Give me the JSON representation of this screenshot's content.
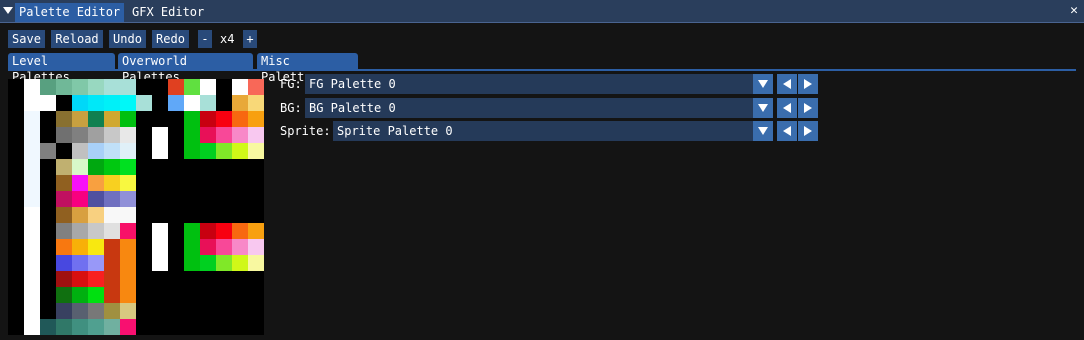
{
  "tabs": [
    {
      "label": "Palette Editor",
      "active": true
    },
    {
      "label": "GFX Editor",
      "active": false
    }
  ],
  "close_symbol": "✕",
  "toolbar": {
    "save": "Save",
    "reload": "Reload",
    "undo": "Undo",
    "redo": "Redo",
    "zoom_out": "-",
    "zoom": "x4",
    "zoom_in": "+"
  },
  "palette_tabs": [
    "Level Palettes",
    "Overworld Palettes",
    "Misc Palettes"
  ],
  "selectors": {
    "fg": {
      "label": "FG:",
      "value": "FG Palette 0"
    },
    "bg": {
      "label": "BG:",
      "value": "BG Palette 0"
    },
    "sprite": {
      "label": "Sprite:",
      "value": "Sprite Palette 0"
    }
  },
  "icons": {
    "collapse": "triangle-down-icon",
    "close": "close-icon",
    "dropdown": "triangle-down-icon",
    "prev": "triangle-left-icon",
    "next": "triangle-right-icon"
  },
  "colors": {
    "tabbar": "#2a3e5c",
    "active_tab": "#2c5ea4",
    "button": "#294a7a",
    "combo": "#253a59",
    "arrow_button": "#3a6dad",
    "background": "#141414"
  },
  "palette_grid": [
    [
      "#000000",
      "#ffffff",
      "#58a080",
      "#70b898",
      "#80c8a8",
      "#98d8c0",
      "#a8e0d8",
      "#a8e0d8",
      "#000000",
      "#000000",
      "#e04020",
      "#60e040",
      "#ffffff",
      "#000000",
      "#ffffff",
      "#f86858"
    ],
    [
      "#000000",
      "#ffffff",
      "#ffffff",
      "#000000",
      "#00d8f8",
      "#00e8f8",
      "#00f0f8",
      "#00f8f8",
      "#a8e0d8",
      "#000000",
      "#60a8f8",
      "#ffffff",
      "#a8e0d8",
      "#000000",
      "#e8a838",
      "#f8d878"
    ],
    [
      "#000000",
      "#f0f8ff",
      "#000000",
      "#887030",
      "#c8a040",
      "#108050",
      "#d0a830",
      "#00c010",
      "#000000",
      "#000000",
      "#000000",
      "#00c010",
      "#c80010",
      "#f80010",
      "#f86810",
      "#f8a010"
    ],
    [
      "#000000",
      "#f0f8ff",
      "#000000",
      "#707070",
      "#808080",
      "#a0a0a0",
      "#c8c8c8",
      "#e8e8e8",
      "#000000",
      "#ffffff",
      "#000000",
      "#00c010",
      "#e81058",
      "#f84898",
      "#f888c8",
      "#f8c8f0"
    ],
    [
      "#000000",
      "#f0f8ff",
      "#808080",
      "#000000",
      "#c0c0c0",
      "#a8d0f8",
      "#c0e0f8",
      "#e0f0f8",
      "#000000",
      "#ffffff",
      "#000000",
      "#00c010",
      "#00d020",
      "#80e828",
      "#d0f818",
      "#f8f8a0"
    ],
    [
      "#000000",
      "#f0f8ff",
      "#000000",
      "#c0b070",
      "#d8f8c8",
      "#00a810",
      "#00c810",
      "#00e020",
      "#000000",
      "#000000",
      "#000000",
      "#000000",
      "#000000",
      "#000000",
      "#000000",
      "#000000"
    ],
    [
      "#000000",
      "#f0f8ff",
      "#000000",
      "#906020",
      "#f810f8",
      "#f8a040",
      "#f8d020",
      "#f8f840",
      "#000000",
      "#000000",
      "#000000",
      "#000000",
      "#000000",
      "#000000",
      "#000000",
      "#000000"
    ],
    [
      "#000000",
      "#f0f8ff",
      "#000000",
      "#c01060",
      "#f80080",
      "#5050a0",
      "#7070c0",
      "#9090d8",
      "#000000",
      "#000000",
      "#000000",
      "#000000",
      "#000000",
      "#000000",
      "#000000",
      "#000000"
    ],
    [
      "#000000",
      "#ffffff",
      "#000000",
      "#906020",
      "#d8a040",
      "#f8d080",
      "#f8f8f8",
      "#f8f8f8",
      "#000000",
      "#000000",
      "#000000",
      "#000000",
      "#000000",
      "#000000",
      "#000000",
      "#000000"
    ],
    [
      "#000000",
      "#ffffff",
      "#000000",
      "#808080",
      "#a8a8a8",
      "#c8c8c8",
      "#e0e0e0",
      "#f81068",
      "#000000",
      "#ffffff",
      "#000000",
      "#00c010",
      "#c80010",
      "#f80010",
      "#f86810",
      "#f8a010"
    ],
    [
      "#000000",
      "#ffffff",
      "#000000",
      "#f87810",
      "#f8b008",
      "#f8e810",
      "#c83810",
      "#f88810",
      "#000000",
      "#ffffff",
      "#000000",
      "#00c010",
      "#e81058",
      "#f84898",
      "#f888c8",
      "#f8c8f0"
    ],
    [
      "#000000",
      "#ffffff",
      "#000000",
      "#4848e0",
      "#7070f0",
      "#9898f8",
      "#c83810",
      "#f88810",
      "#000000",
      "#ffffff",
      "#000000",
      "#00c010",
      "#00d020",
      "#80e828",
      "#d0f818",
      "#f8f8a0"
    ],
    [
      "#000000",
      "#ffffff",
      "#000000",
      "#a01010",
      "#d81010",
      "#f82020",
      "#c83810",
      "#f88810",
      "#000000",
      "#000000",
      "#000000",
      "#000000",
      "#000000",
      "#000000",
      "#000000",
      "#000000"
    ],
    [
      "#000000",
      "#ffffff",
      "#000000",
      "#107010",
      "#00b010",
      "#00e010",
      "#c83810",
      "#f88810",
      "#000000",
      "#000000",
      "#000000",
      "#000000",
      "#000000",
      "#000000",
      "#000000",
      "#000000"
    ],
    [
      "#000000",
      "#ffffff",
      "#000000",
      "#384060",
      "#586070",
      "#787878",
      "#a09040",
      "#d8c880",
      "#000000",
      "#000000",
      "#000000",
      "#000000",
      "#000000",
      "#000000",
      "#000000",
      "#000000"
    ],
    [
      "#000000",
      "#ffffff",
      "#205858",
      "#307868",
      "#409080",
      "#50a090",
      "#70b0a0",
      "#f81070",
      "#000000",
      "#000000",
      "#000000",
      "#000000",
      "#000000",
      "#000000",
      "#000000",
      "#000000"
    ]
  ]
}
